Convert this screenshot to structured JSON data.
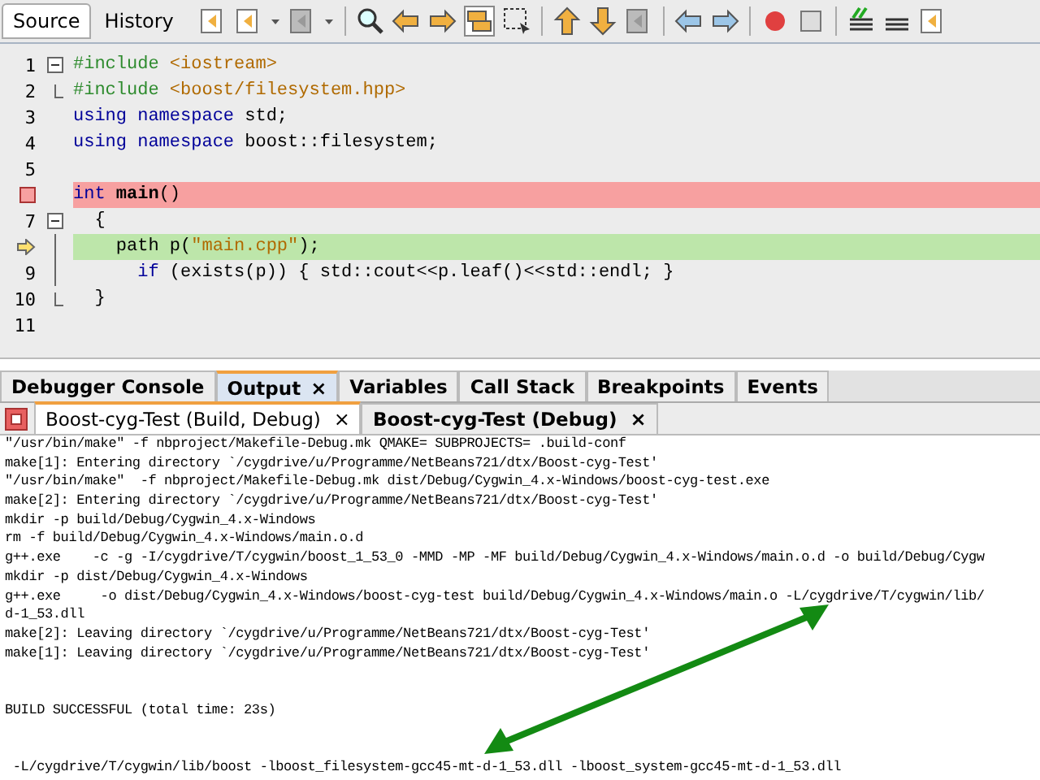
{
  "editor_tabs": [
    {
      "label": "Source",
      "selected": true
    },
    {
      "label": "History",
      "selected": false
    }
  ],
  "code_lines": [
    {
      "number": "1",
      "breakpoint": false,
      "current": false,
      "fold_start": true,
      "fold_body": false,
      "fold_end": false,
      "segments": [
        {
          "text": "#include ",
          "kind": "pre"
        },
        {
          "text": "<iostream>",
          "kind": "str"
        }
      ]
    },
    {
      "number": "2",
      "breakpoint": false,
      "current": false,
      "fold_start": false,
      "fold_body": false,
      "fold_end": true,
      "segments": [
        {
          "text": "#include ",
          "kind": "pre"
        },
        {
          "text": "<boost/filesystem.hpp>",
          "kind": "str"
        }
      ]
    },
    {
      "number": "3",
      "breakpoint": false,
      "current": false,
      "fold_start": false,
      "fold_body": false,
      "fold_end": false,
      "segments": [
        {
          "text": "using namespace",
          "kind": "kw"
        },
        {
          "text": " std;",
          "kind": "plain"
        }
      ]
    },
    {
      "number": "4",
      "breakpoint": false,
      "current": false,
      "fold_start": false,
      "fold_body": false,
      "fold_end": false,
      "segments": [
        {
          "text": "using namespace",
          "kind": "kw"
        },
        {
          "text": " boost::filesystem;",
          "kind": "plain"
        }
      ]
    },
    {
      "number": "5",
      "breakpoint": false,
      "current": false,
      "fold_start": false,
      "fold_body": false,
      "fold_end": false
    },
    {
      "breakpoint": true,
      "current": false,
      "fold_start": false,
      "fold_body": false,
      "fold_end": false,
      "segments": [
        {
          "text": "int",
          "kind": "kw"
        },
        {
          "text": " main",
          "kind": "name"
        },
        {
          "text": "()",
          "kind": "plain"
        }
      ]
    },
    {
      "number": "7",
      "breakpoint": false,
      "current": false,
      "fold_start": true,
      "fold_body": false,
      "fold_end": false,
      "segments": [
        {
          "text": "  {",
          "kind": "plain"
        }
      ]
    },
    {
      "breakpoint": false,
      "current": true,
      "fold_start": false,
      "fold_body": true,
      "fold_end": false,
      "segments": [
        {
          "text": "    path p(",
          "kind": "plain"
        },
        {
          "text": "\"main.cpp\"",
          "kind": "str"
        },
        {
          "text": ");",
          "kind": "plain"
        }
      ]
    },
    {
      "number": "9",
      "breakpoint": false,
      "current": false,
      "fold_start": false,
      "fold_body": true,
      "fold_end": false,
      "segments": [
        {
          "text": "      if",
          "kind": "kw"
        },
        {
          "text": " (exists(p)) { std::cout<<p.leaf()<<std::endl; }",
          "kind": "plain"
        }
      ]
    },
    {
      "number": "10",
      "breakpoint": false,
      "current": false,
      "fold_start": false,
      "fold_body": false,
      "fold_end": true,
      "segments": [
        {
          "text": "  }",
          "kind": "plain"
        }
      ]
    },
    {
      "number": "11",
      "breakpoint": false,
      "current": false,
      "fold_start": false,
      "fold_body": false,
      "fold_end": false
    }
  ],
  "debug_tabs": [
    {
      "label": "Debugger Console",
      "selected": false,
      "closable": false
    },
    {
      "label": "Output",
      "selected": true,
      "closable": true
    },
    {
      "label": "Variables",
      "selected": false,
      "closable": false
    },
    {
      "label": "Call Stack",
      "selected": false,
      "closable": false
    },
    {
      "label": "Breakpoints",
      "selected": false,
      "closable": false
    },
    {
      "label": "Events",
      "selected": false,
      "closable": false
    }
  ],
  "close_glyph": "×",
  "output_tabs": [
    {
      "label": "Boost-cyg-Test (Build, Debug)",
      "selected": true,
      "close": "×"
    },
    {
      "label": "Boost-cyg-Test (Debug)",
      "selected": false,
      "close": "×"
    }
  ],
  "output_lines": [
    {
      "text": "\"/usr/bin/make\" -f nbproject/Makefile-Debug.mk QMAKE= SUBPROJECTS= .build-conf",
      "gap_before": false
    },
    {
      "text": "make[1]: Entering directory `/cygdrive/u/Programme/NetBeans721/dtx/Boost-cyg-Test'",
      "gap_before": false
    },
    {
      "text": "\"/usr/bin/make\"  -f nbproject/Makefile-Debug.mk dist/Debug/Cygwin_4.x-Windows/boost-cyg-test.exe",
      "gap_before": false
    },
    {
      "text": "make[2]: Entering directory `/cygdrive/u/Programme/NetBeans721/dtx/Boost-cyg-Test'",
      "gap_before": false
    },
    {
      "text": "mkdir -p build/Debug/Cygwin_4.x-Windows",
      "gap_before": false
    },
    {
      "text": "rm -f build/Debug/Cygwin_4.x-Windows/main.o.d",
      "gap_before": false
    },
    {
      "text": "g++.exe    -c -g -I/cygdrive/T/cygwin/boost_1_53_0 -MMD -MP -MF build/Debug/Cygwin_4.x-Windows/main.o.d -o build/Debug/Cygw",
      "gap_before": false
    },
    {
      "text": "mkdir -p dist/Debug/Cygwin_4.x-Windows",
      "gap_before": false
    },
    {
      "text": "g++.exe     -o dist/Debug/Cygwin_4.x-Windows/boost-cyg-test build/Debug/Cygwin_4.x-Windows/main.o -L/cygdrive/T/cygwin/lib/",
      "gap_before": false
    },
    {
      "text": "d-1_53.dll",
      "gap_before": false
    },
    {
      "text": "make[2]: Leaving directory `/cygdrive/u/Programme/NetBeans721/dtx/Boost-cyg-Test'",
      "gap_before": false
    },
    {
      "text": "make[1]: Leaving directory `/cygdrive/u/Programme/NetBeans721/dtx/Boost-cyg-Test'",
      "gap_before": false
    },
    {
      "text": "BUILD SUCCESSFUL (total time: 23s)",
      "gap_before": true
    },
    {
      "text": " -L/cygdrive/T/cygwin/lib/boost -lboost_filesystem-gcc45-mt-d-1_53.dll -lboost_system-gcc45-mt-d-1_53.dll",
      "gap_before": true
    }
  ]
}
